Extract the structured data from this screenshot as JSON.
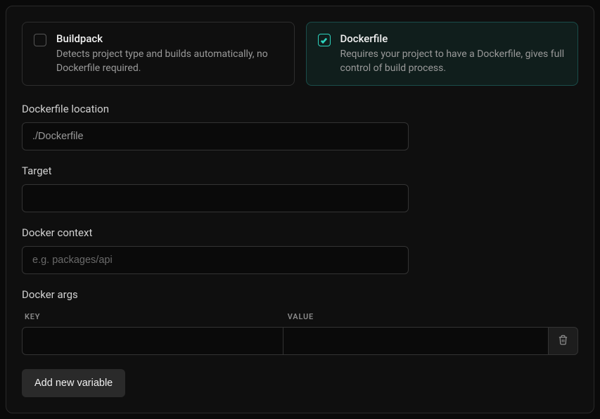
{
  "build_options": {
    "buildpack": {
      "title": "Buildpack",
      "description": "Detects project type and builds automatically, no Dockerfile required.",
      "selected": false
    },
    "dockerfile": {
      "title": "Dockerfile",
      "description": "Requires your project to have a Dockerfile, gives full control of build process.",
      "selected": true
    }
  },
  "fields": {
    "dockerfile_location": {
      "label": "Dockerfile location",
      "value": "./Dockerfile",
      "placeholder": ""
    },
    "target": {
      "label": "Target",
      "value": "",
      "placeholder": ""
    },
    "docker_context": {
      "label": "Docker context",
      "value": "",
      "placeholder": "e.g. packages/api"
    }
  },
  "docker_args": {
    "label": "Docker args",
    "key_header": "KEY",
    "value_header": "VALUE",
    "rows": [
      {
        "key": "",
        "value": ""
      }
    ],
    "add_button_label": "Add new variable"
  }
}
